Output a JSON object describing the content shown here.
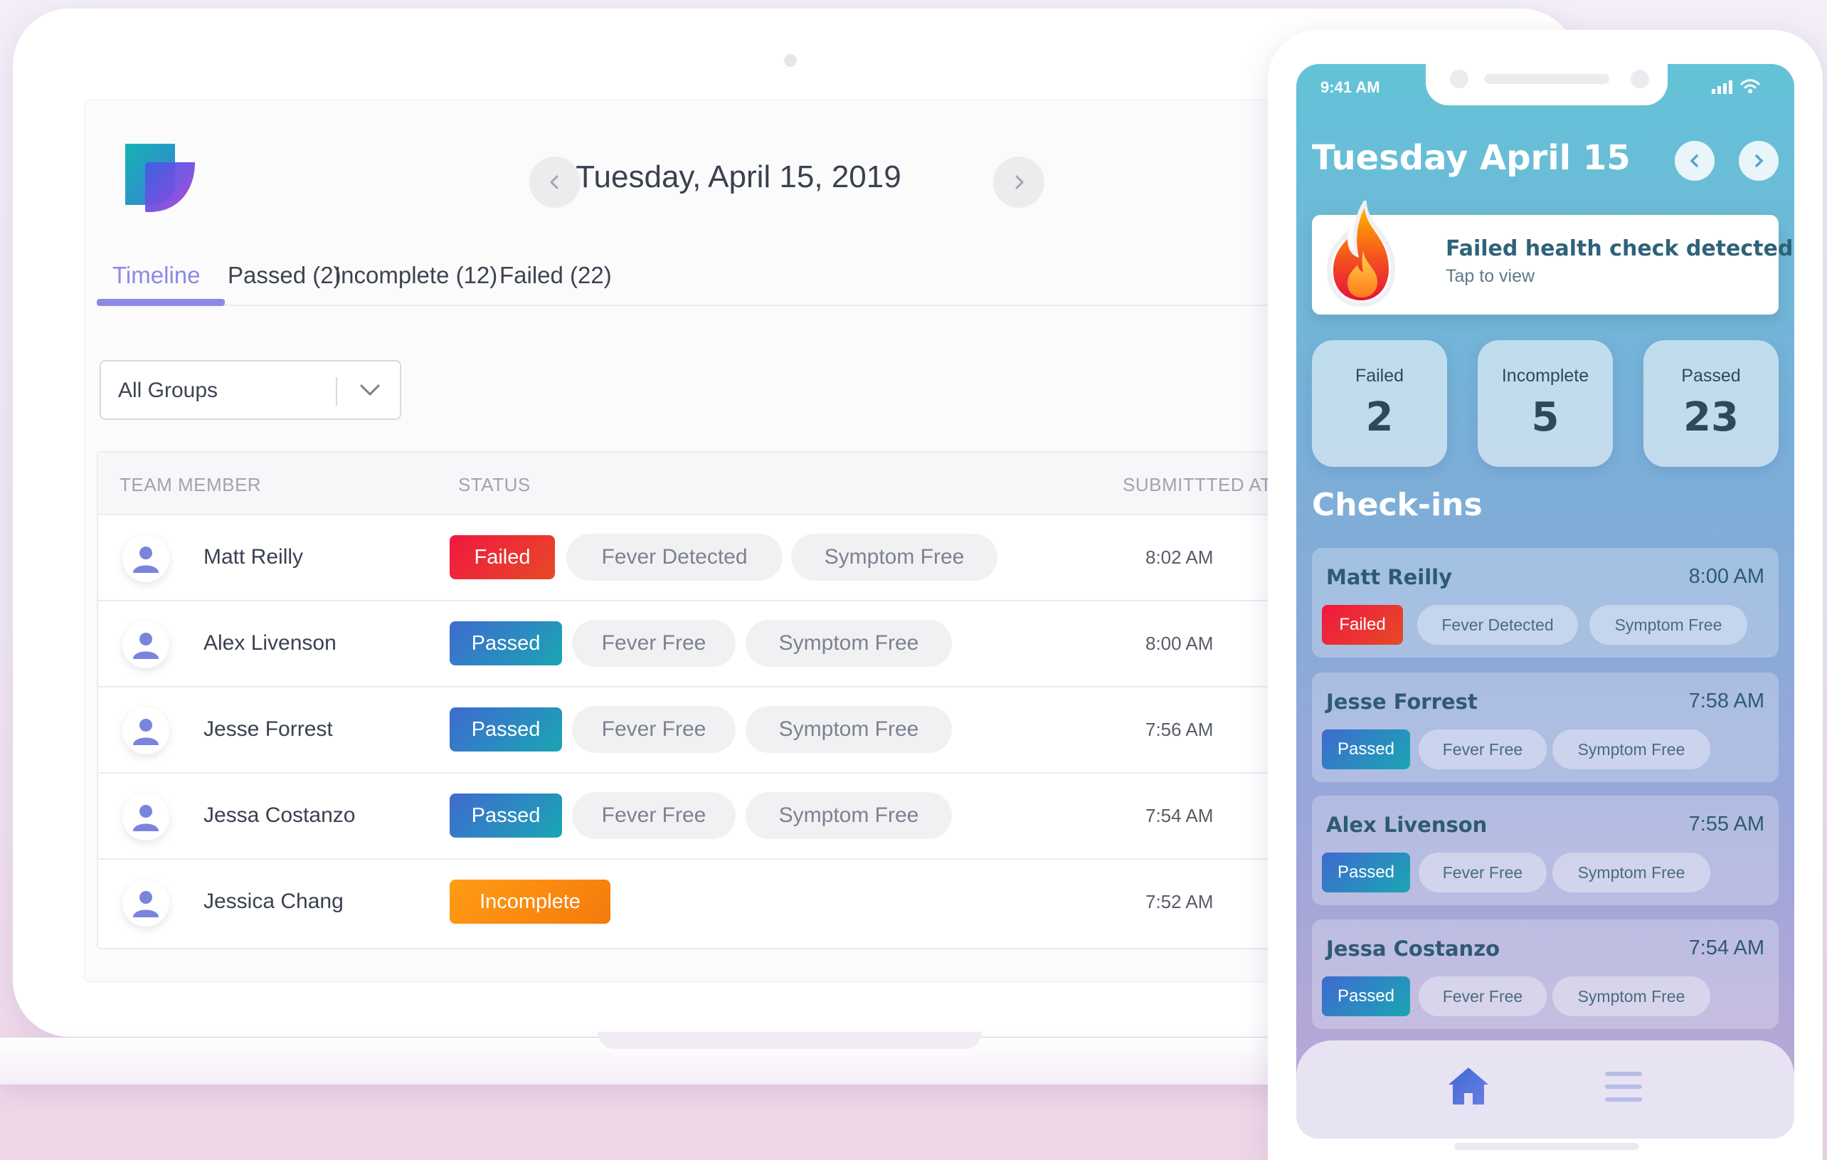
{
  "desktop": {
    "date_title": "Tuesday, April 15, 2019",
    "prev_label": "‹",
    "next_label": "›",
    "tabs": [
      {
        "label": "Timeline"
      },
      {
        "label": "Passed (2)"
      },
      {
        "label": "Incomplete (12)"
      },
      {
        "label": "Failed (22)"
      }
    ],
    "filter": {
      "value": "All Groups"
    },
    "table": {
      "headers": [
        "TEAM MEMBER",
        "STATUS",
        "SUBMITTTED AT"
      ],
      "rows": [
        {
          "name": "Matt Reilly",
          "status": "Failed",
          "fever": "Fever Detected",
          "symptom": "Symptom Free",
          "time": "8:02 AM"
        },
        {
          "name": "Alex Livenson",
          "status": "Passed",
          "fever": "Fever Free",
          "symptom": "Symptom Free",
          "time": "8:00 AM"
        },
        {
          "name": "Jesse Forrest",
          "status": "Passed",
          "fever": "Fever Free",
          "symptom": "Symptom Free",
          "time": "7:56 AM"
        },
        {
          "name": "Jessa Costanzo",
          "status": "Passed",
          "fever": "Fever Free",
          "symptom": "Symptom Free",
          "time": "7:54 AM"
        },
        {
          "name": "Jessica Chang",
          "status": "Incomplete",
          "time": "7:52 AM"
        }
      ]
    }
  },
  "mobile": {
    "status_time": "9:41 AM",
    "date_title": "Tuesday April 15",
    "alert": {
      "title": "Failed health check detected",
      "subtitle": "Tap to view"
    },
    "stats": [
      {
        "label": "Failed",
        "value": "2"
      },
      {
        "label": "Incomplete",
        "value": "5"
      },
      {
        "label": "Passed",
        "value": "23"
      }
    ],
    "checkins_title": "Check-ins",
    "checkins": [
      {
        "name": "Matt Reilly",
        "time": "8:00 AM",
        "status": "Failed",
        "fever": "Fever Detected",
        "symptom": "Symptom Free"
      },
      {
        "name": "Jesse Forrest",
        "time": "7:58 AM",
        "status": "Passed",
        "fever": "Fever Free",
        "symptom": "Symptom Free"
      },
      {
        "name": "Alex Livenson",
        "time": "7:55 AM",
        "status": "Passed",
        "fever": "Fever Free",
        "symptom": "Symptom Free"
      },
      {
        "name": "Jessa Costanzo",
        "time": "7:54 AM",
        "status": "Passed",
        "fever": "Fever Free",
        "symptom": "Symptom Free"
      }
    ]
  },
  "colors": {
    "accent": "#8b89e6",
    "failed": "#f0183f",
    "passed": "#1aa6b3",
    "incomplete": "#ff9c14"
  },
  "icons": [
    "logo-icon",
    "chevron-left-icon",
    "chevron-right-icon",
    "chevron-down-icon",
    "user-icon",
    "flame-icon",
    "home-icon",
    "menu-icon",
    "signal-icon",
    "wifi-icon"
  ]
}
